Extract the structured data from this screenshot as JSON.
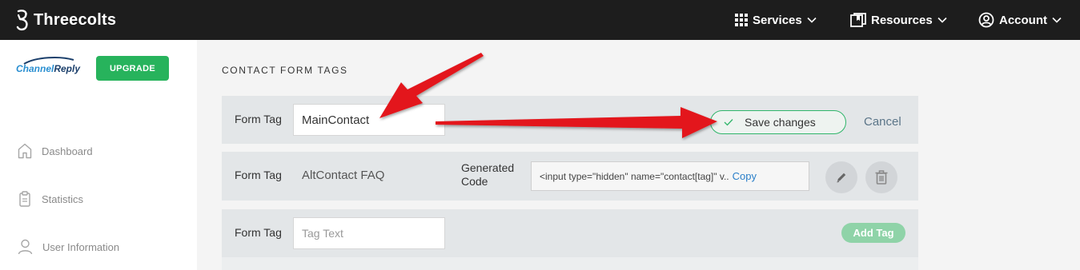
{
  "app": {
    "brand": "Threecolts",
    "nav": [
      {
        "label": "Services",
        "icon": "grid-icon"
      },
      {
        "label": "Resources",
        "icon": "book-icon"
      },
      {
        "label": "Account",
        "icon": "user-circle-icon"
      }
    ]
  },
  "sidebar": {
    "logo_part1": "Channel",
    "logo_part2": "Reply",
    "upgrade_label": "UPGRADE",
    "items": [
      {
        "label": "Dashboard",
        "icon": "home-icon"
      },
      {
        "label": "Statistics",
        "icon": "clipboard-icon"
      },
      {
        "label": "User Information",
        "icon": "user-icon"
      }
    ]
  },
  "main": {
    "section_title": "CONTACT FORM TAGS",
    "rows": [
      {
        "label": "Form Tag",
        "input_value": "MainContact",
        "save_label": "Save changes",
        "cancel_label": "Cancel"
      },
      {
        "label": "Form Tag",
        "tag_value": "AltContact FAQ",
        "generated_label": "Generated Code",
        "code_value": "<input type=\"hidden\" name=\"contact[tag]\" v..",
        "copy_label": "Copy"
      },
      {
        "label": "Form Tag",
        "input_placeholder": "Tag Text",
        "add_label": "Add Tag"
      }
    ]
  },
  "colors": {
    "topbar": "#1d1d1d",
    "accent_green": "#27b35c",
    "arrow_red": "#e3161b",
    "link_blue": "#2a7fc9"
  }
}
